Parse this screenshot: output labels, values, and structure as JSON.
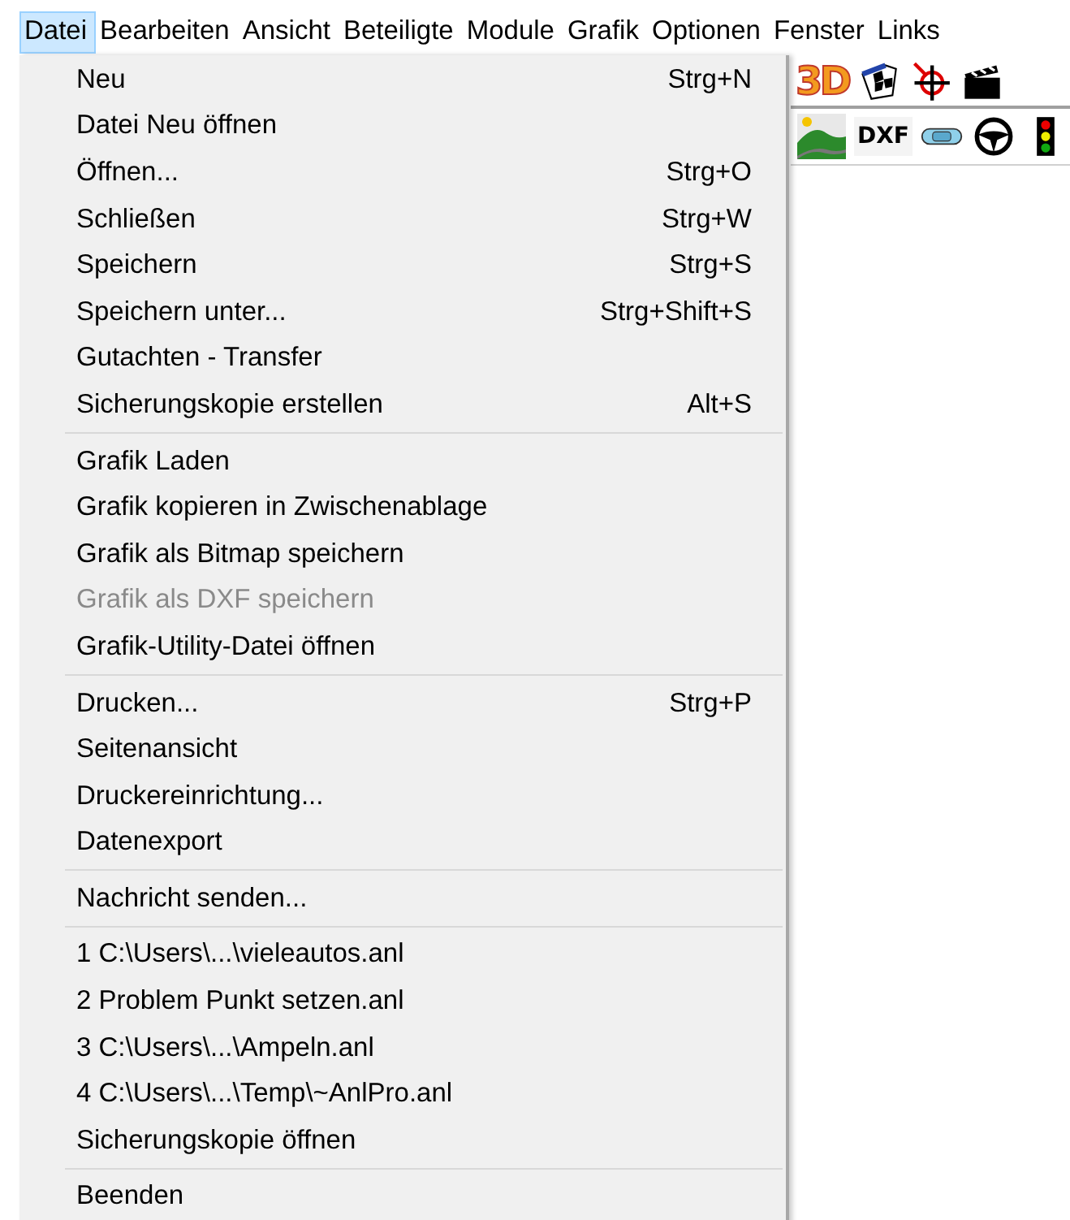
{
  "menu_bar": [
    {
      "label": "Datei",
      "selected": true
    },
    {
      "label": "Bearbeiten",
      "selected": false
    },
    {
      "label": "Ansicht",
      "selected": false
    },
    {
      "label": "Beteiligte",
      "selected": false
    },
    {
      "label": "Module",
      "selected": false
    },
    {
      "label": "Grafik",
      "selected": false
    },
    {
      "label": "Optionen",
      "selected": false
    },
    {
      "label": "Fenster",
      "selected": false
    },
    {
      "label": "Links",
      "selected": false
    }
  ],
  "toolbar_1": [
    {
      "kind": "logo3d",
      "text": "3D"
    },
    {
      "kind": "flag"
    },
    {
      "kind": "crosshair"
    },
    {
      "kind": "clapper"
    }
  ],
  "toolbar_2": [
    {
      "kind": "landscape"
    },
    {
      "kind": "textbtn",
      "text": "DXF"
    },
    {
      "kind": "car"
    },
    {
      "kind": "wheel"
    },
    {
      "kind": "light"
    }
  ],
  "menu": [
    {
      "kind": "item",
      "label": "Neu",
      "shortcut": "Strg+N",
      "disabled": false
    },
    {
      "kind": "item",
      "label": "Datei Neu öffnen",
      "disabled": false
    },
    {
      "kind": "item",
      "label": "Öffnen...",
      "shortcut": "Strg+O",
      "disabled": false
    },
    {
      "kind": "item",
      "label": "Schließen",
      "shortcut": "Strg+W",
      "disabled": false
    },
    {
      "kind": "item",
      "label": "Speichern",
      "shortcut": "Strg+S",
      "disabled": false
    },
    {
      "kind": "item",
      "label": "Speichern unter...",
      "shortcut": "Strg+Shift+S",
      "disabled": false
    },
    {
      "kind": "item",
      "label": "Gutachten - Transfer",
      "disabled": false
    },
    {
      "kind": "item",
      "label": "Sicherungskopie erstellen",
      "shortcut": "Alt+S",
      "disabled": false
    },
    {
      "kind": "separator"
    },
    {
      "kind": "item",
      "label": "Grafik Laden",
      "disabled": false
    },
    {
      "kind": "item",
      "label": "Grafik kopieren in Zwischenablage",
      "disabled": false
    },
    {
      "kind": "item",
      "label": "Grafik als Bitmap speichern",
      "disabled": false
    },
    {
      "kind": "item",
      "label": "Grafik als DXF speichern",
      "disabled": true
    },
    {
      "kind": "item",
      "label": "Grafik-Utility-Datei öffnen",
      "disabled": false
    },
    {
      "kind": "separator"
    },
    {
      "kind": "item",
      "label": "Drucken...",
      "shortcut": "Strg+P",
      "disabled": false
    },
    {
      "kind": "item",
      "label": "Seitenansicht",
      "disabled": false
    },
    {
      "kind": "item",
      "label": "Druckereinrichtung...",
      "disabled": false
    },
    {
      "kind": "item",
      "label": "Datenexport",
      "disabled": false
    },
    {
      "kind": "separator"
    },
    {
      "kind": "item",
      "label": "Nachricht senden...",
      "disabled": false
    },
    {
      "kind": "separator"
    },
    {
      "kind": "item",
      "label": "1 C:\\Users\\...\\vieleautos.anl",
      "disabled": false
    },
    {
      "kind": "item",
      "label": "2 Problem Punkt setzen.anl",
      "disabled": false
    },
    {
      "kind": "item",
      "label": "3 C:\\Users\\...\\Ampeln.anl",
      "disabled": false
    },
    {
      "kind": "item",
      "label": "4 C:\\Users\\...\\Temp\\~AnlPro.anl",
      "disabled": false
    },
    {
      "kind": "item",
      "label": "Sicherungskopie öffnen",
      "disabled": false
    },
    {
      "kind": "separator"
    },
    {
      "kind": "item",
      "label": "Beenden",
      "disabled": false
    }
  ]
}
